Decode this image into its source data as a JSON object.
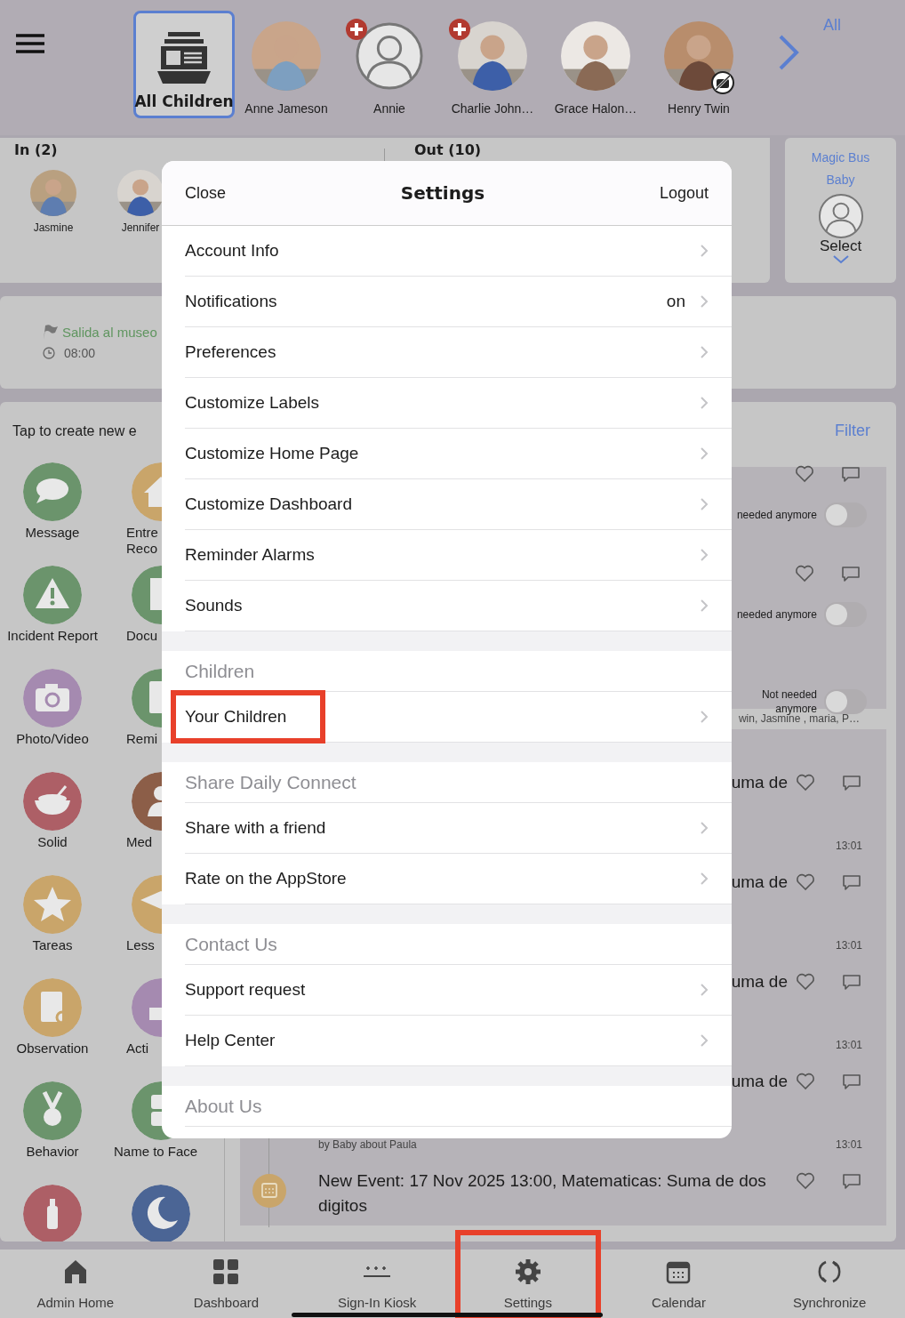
{
  "children_bar": {
    "items": [
      {
        "name": "All Children",
        "kind": "all",
        "selected": true
      },
      {
        "name": "Anne Jameson",
        "selected": false,
        "alert": false,
        "photo_off": false
      },
      {
        "name": "Annie",
        "kind": "placeholder",
        "selected": false,
        "alert": true,
        "photo_off": false
      },
      {
        "name": "Charlie John…",
        "selected": false,
        "alert": true,
        "photo_off": false
      },
      {
        "name": "Grace Halon…",
        "selected": false,
        "alert": false,
        "photo_off": false
      },
      {
        "name": "Henry Twin",
        "selected": false,
        "alert": false,
        "photo_off": true
      }
    ],
    "more": "All"
  },
  "in_panel": {
    "title": "In (2)",
    "children": [
      {
        "name": "Jasmine"
      },
      {
        "name": "Jennifer"
      }
    ]
  },
  "out_panel": {
    "title": "Out (10)"
  },
  "bus_card": {
    "title": "Magic Bus Baby",
    "select": "Select"
  },
  "event": {
    "title": "Salida al museo",
    "time": "08:00"
  },
  "create": {
    "prompt": "Tap to create new e",
    "actions": [
      {
        "label": "Message",
        "color": "#6b946c"
      },
      {
        "label": "Entre\nReco",
        "color": "#c9a56a"
      },
      {
        "label": "Incident Report",
        "color": "#6b946c"
      },
      {
        "label": "Docu",
        "color": "#6b946c"
      },
      {
        "label": "Photo/Video",
        "color": "#a58ab0"
      },
      {
        "label": "Remi",
        "color": "#6b946c"
      },
      {
        "label": "Solid",
        "color": "#ad5f66"
      },
      {
        "label": "Med",
        "color": "#8c5e48"
      },
      {
        "label": "Tareas",
        "color": "#c9a56a"
      },
      {
        "label": "Less",
        "color": "#c9a56a"
      },
      {
        "label": "Observation",
        "color": "#c9a56a"
      },
      {
        "label": "Acti",
        "color": "#a58ab0"
      },
      {
        "label": "Behavior",
        "color": "#6b946c"
      },
      {
        "label": "Name to Face",
        "color": "#6b946c"
      },
      {
        "color": "#ad5f66"
      },
      {
        "color": "#4b6595"
      }
    ]
  },
  "feed": {
    "filter": "Filter",
    "toggle_entries": [
      {
        "reactions": true,
        "label": "needed anymore",
        "on": false
      },
      {
        "reactions": true,
        "label": "needed anymore",
        "on": false
      },
      {
        "reactions": false,
        "label": "Not needed anymore",
        "on": false,
        "tagged": "win, Jasmine , maria, P…"
      }
    ],
    "entries": [
      {
        "kind": "fragment",
        "title": "uma de"
      },
      {
        "kind": "fragment",
        "time": "13:01",
        "title": "uma de"
      },
      {
        "kind": "fragment",
        "time": "13:01",
        "title": "uma de"
      },
      {
        "kind": "fragment",
        "time": "13:01",
        "title": "uma de"
      },
      {
        "kind": "event",
        "byline": "by Baby about Paula",
        "time": "13:01",
        "title": "New Event: 17 Nov 2025 13:00, Matematicas: Suma de dos digitos"
      }
    ]
  },
  "settings": {
    "close": "Close",
    "title": "Settings",
    "logout": "Logout",
    "sections": [
      {
        "items": [
          {
            "label": "Account Info",
            "highlighted": false
          },
          {
            "label": "Notifications",
            "value": "on",
            "highlighted": false
          },
          {
            "label": "Preferences",
            "highlighted": false
          },
          {
            "label": "Customize Labels",
            "highlighted": false
          },
          {
            "label": "Customize Home Page",
            "highlighted": false
          },
          {
            "label": "Customize Dashboard",
            "highlighted": false
          },
          {
            "label": "Reminder Alarms",
            "highlighted": false
          },
          {
            "label": "Sounds",
            "highlighted": false
          }
        ]
      },
      {
        "header": "Children",
        "items": [
          {
            "label": "Your Children",
            "highlighted": true
          }
        ]
      },
      {
        "header": "Share Daily Connect",
        "items": [
          {
            "label": "Share with a friend",
            "highlighted": false
          },
          {
            "label": "Rate on the AppStore",
            "highlighted": false
          }
        ]
      },
      {
        "header": "Contact Us",
        "items": [
          {
            "label": "Support request",
            "highlighted": false
          },
          {
            "label": "Help Center",
            "highlighted": false
          }
        ]
      },
      {
        "header": "About Us"
      }
    ]
  },
  "tab_bar": [
    {
      "label": "Admin Home",
      "highlighted": false
    },
    {
      "label": "Dashboard",
      "highlighted": false
    },
    {
      "label": "Sign-In Kiosk",
      "highlighted": false
    },
    {
      "label": "Settings",
      "highlighted": true
    },
    {
      "label": "Calendar",
      "highlighted": false
    },
    {
      "label": "Synchronize",
      "highlighted": false
    }
  ]
}
